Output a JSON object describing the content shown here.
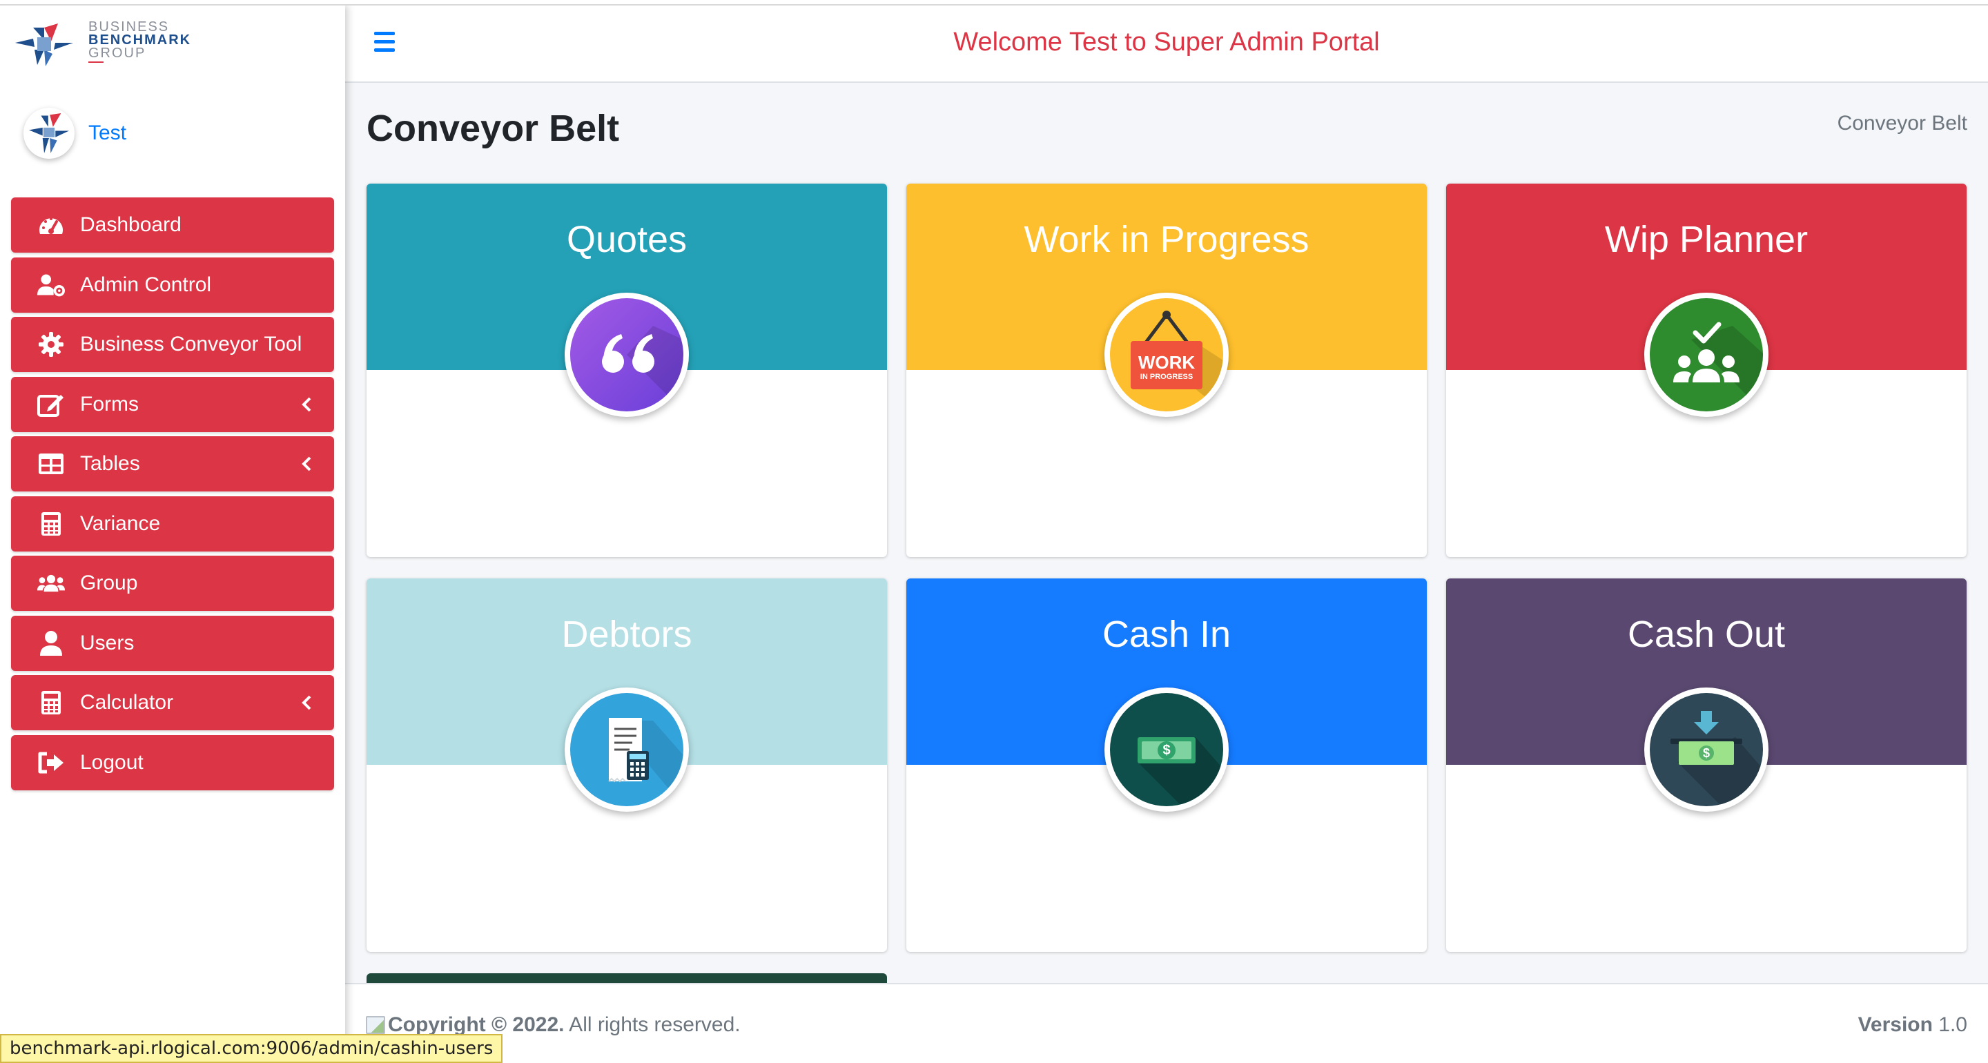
{
  "brand": {
    "line1": "BUSINESS",
    "line2": "BENCHMARK",
    "line3": "GROUP",
    "colors": {
      "blue": "#1f4e8c",
      "red": "#dc3545"
    }
  },
  "user": {
    "name": "Test"
  },
  "sidebar": {
    "items": [
      {
        "label": "Dashboard",
        "icon": "tachometer-icon"
      },
      {
        "label": "Admin Control",
        "icon": "user-cog-icon"
      },
      {
        "label": "Business Conveyor Tool",
        "icon": "gear-icon"
      },
      {
        "label": "Forms",
        "icon": "edit-icon",
        "has_submenu": true
      },
      {
        "label": "Tables",
        "icon": "table-icon",
        "has_submenu": true
      },
      {
        "label": "Variance",
        "icon": "calculator-icon"
      },
      {
        "label": "Group",
        "icon": "users-icon"
      },
      {
        "label": "Users",
        "icon": "user-icon"
      },
      {
        "label": "Calculator",
        "icon": "calculator-icon",
        "has_submenu": true
      },
      {
        "label": "Logout",
        "icon": "sign-out-icon"
      }
    ],
    "item_color": "#dc3545"
  },
  "header": {
    "welcome": "Welcome Test to Super Admin Portal",
    "menu_icon": "hamburger-icon"
  },
  "page": {
    "title": "Conveyor Belt",
    "breadcrumb": "Conveyor Belt"
  },
  "cards": [
    {
      "title": "Quotes",
      "color": "#24a1b7",
      "icon": "quote-icon"
    },
    {
      "title": "Work in Progress",
      "color": "#fdbf2d",
      "icon": "work-in-progress-sign-icon",
      "icon_text_1": "WORK",
      "icon_text_2": "IN PROGRESS"
    },
    {
      "title": "Wip Planner",
      "color": "#dc3545",
      "icon": "team-check-icon"
    },
    {
      "title": "Debtors",
      "color": "#b3dfe5",
      "icon": "invoice-calculator-icon"
    },
    {
      "title": "Cash In",
      "color": "#157bff",
      "icon": "cash-icon",
      "icon_text": "$"
    },
    {
      "title": "Cash Out",
      "color": "#5a4870",
      "icon": "cash-withdraw-icon",
      "icon_text": "$"
    }
  ],
  "footer": {
    "copyright": "Copyright © 2022.",
    "rights": " All rights reserved.",
    "version_label": "Version",
    "version": " 1.0"
  },
  "status_url": "benchmark-api.rlogical.com:9006/admin/cashin-users"
}
